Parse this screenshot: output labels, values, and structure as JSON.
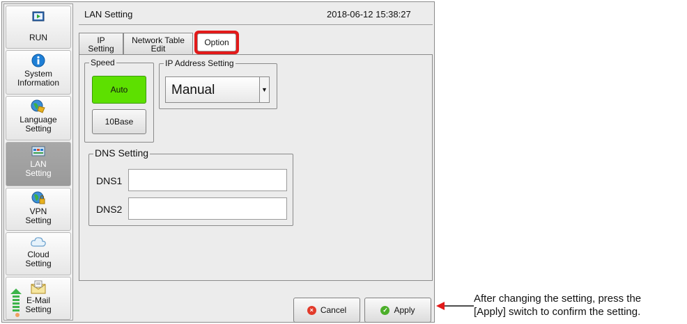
{
  "sidebar": {
    "items": [
      {
        "label": "RUN",
        "icon": "run-icon"
      },
      {
        "label": "System\nInformation",
        "icon": "info-icon"
      },
      {
        "label": "Language\nSetting",
        "icon": "globe-icon"
      },
      {
        "label": "LAN\nSetting",
        "icon": "lan-icon",
        "active": true
      },
      {
        "label": "VPN\nSetting",
        "icon": "vpn-icon"
      },
      {
        "label": "Cloud\nSetting",
        "icon": "cloud-icon"
      },
      {
        "label": "E-Mail\nSetting",
        "icon": "email-icon"
      }
    ]
  },
  "header": {
    "title": "LAN Setting",
    "datetime": "2018-06-12  15:38:27"
  },
  "tabs": [
    {
      "label": "IP\nSetting"
    },
    {
      "label": "Network Table\nEdit"
    },
    {
      "label": "Option",
      "selected": true
    }
  ],
  "speed": {
    "legend": "Speed",
    "auto_label": "Auto",
    "base10_label": "10Base",
    "selected": "Auto"
  },
  "ip_address": {
    "legend": "IP Address Setting",
    "value": "Manual"
  },
  "dns": {
    "legend": "DNS Setting",
    "dns1_label": "DNS1",
    "dns1_value": "",
    "dns2_label": "DNS2",
    "dns2_value": ""
  },
  "actions": {
    "cancel_label": "Cancel",
    "apply_label": "Apply"
  },
  "annotation": {
    "line1": "After changing the setting, press the",
    "line2": "[Apply] switch to confirm the setting."
  },
  "colors": {
    "highlight": "#e21a1a",
    "auto_active": "#5de000",
    "apply_icon": "#4caf2a",
    "cancel_icon": "#e23a2a"
  }
}
